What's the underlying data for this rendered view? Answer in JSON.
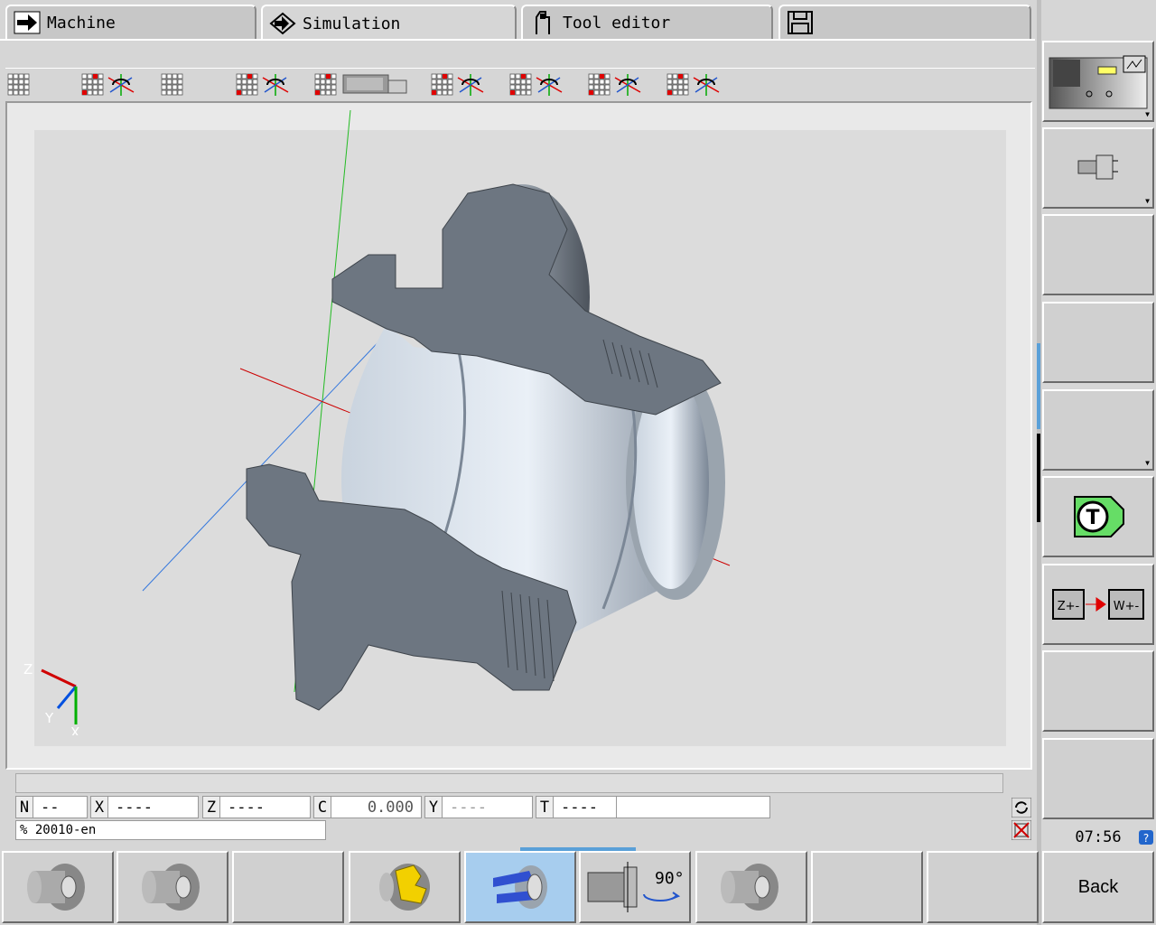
{
  "tabs": [
    {
      "label": "Machine",
      "icon": "arrow-right-icon"
    },
    {
      "label": "Simulation",
      "icon": "arrow-diamond-icon"
    },
    {
      "label": "Tool editor",
      "icon": "tool-holder-icon"
    },
    {
      "label": "",
      "icon": "floppy-disk-icon"
    }
  ],
  "view_toolbar": [
    "grid-view-icon",
    "grid-rotate-icon",
    "grid-view-icon",
    "grid-rotate-icon",
    "grid-tool-icon",
    "grid-rotate-icon",
    "grid-rotate-icon",
    "grid-rotate-icon",
    "grid-rotate-icon"
  ],
  "triad": {
    "z": "Z",
    "y": "Y",
    "x": "X"
  },
  "status": {
    "message": "",
    "fields": [
      {
        "label": "N",
        "value": "--"
      },
      {
        "label": "X",
        "value": "----"
      },
      {
        "label": "Z",
        "value": "----"
      },
      {
        "label": "C",
        "value": "0.000"
      },
      {
        "label": "Y",
        "value": "----"
      },
      {
        "label": "T",
        "value": "----"
      }
    ],
    "program": "% 20010-en",
    "clock": "07:56"
  },
  "right_softkeys": [
    {
      "name": "machine-view-softkey",
      "icon": "lathe-machine-icon"
    },
    {
      "name": "chuck-view-softkey",
      "icon": "spindle-chuck-icon"
    },
    {
      "name": "empty-softkey-3",
      "icon": ""
    },
    {
      "name": "empty-softkey-4",
      "icon": ""
    },
    {
      "name": "empty-softkey-5",
      "icon": ""
    },
    {
      "name": "tool-list-softkey",
      "icon": "tool-t-icon"
    },
    {
      "name": "z-to-w-softkey",
      "icon": "z-to-w-icon",
      "z_label": "Z+-",
      "w_label": "W+-"
    },
    {
      "name": "empty-softkey-8",
      "icon": ""
    },
    {
      "name": "empty-softkey-9",
      "icon": ""
    }
  ],
  "bottom_softkeys": [
    {
      "name": "workpiece-view-1",
      "icon": "workpiece-icon"
    },
    {
      "name": "workpiece-view-2",
      "icon": "workpiece-icon"
    },
    {
      "name": "empty-bottom-3",
      "icon": ""
    },
    {
      "name": "section-view",
      "icon": "section-yellow-icon"
    },
    {
      "name": "half-section-view",
      "icon": "half-section-blue-icon",
      "active": true
    },
    {
      "name": "rotate-90-view",
      "icon": "rotate-90-icon",
      "rotate_label": "90°"
    },
    {
      "name": "full-view",
      "icon": "workpiece-flange-icon"
    },
    {
      "name": "empty-bottom-8",
      "icon": ""
    },
    {
      "name": "empty-bottom-9",
      "icon": ""
    },
    {
      "name": "back-button",
      "label": "Back"
    }
  ],
  "colors": {
    "active_softkey": "#a7cdee",
    "x_axis": "#d00000",
    "y_axis": "#00b000",
    "z_axis": "#0050e0"
  }
}
